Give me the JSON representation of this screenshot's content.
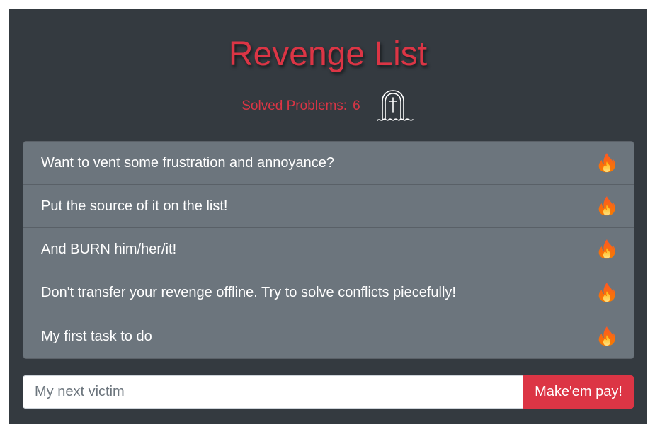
{
  "header": {
    "title": "Revenge List",
    "solved_label": "Solved Problems:",
    "solved_count": "6",
    "solved_icon": "gravestone-icon"
  },
  "todo_list": {
    "item_icon": "fire-icon",
    "items": [
      {
        "text": "Want to vent some frustration and annoyance?"
      },
      {
        "text": "Put the source of it on the list!"
      },
      {
        "text": "And BURN him/her/it!"
      },
      {
        "text": "Don't transfer your revenge offline. Try to solve conflicts piecefully!"
      },
      {
        "text": "My first task to do"
      }
    ]
  },
  "form": {
    "input_placeholder": "My next victim",
    "input_value": "",
    "submit_label": "Make'em pay!"
  },
  "colors": {
    "panel_bg": "#343a40",
    "accent_red": "#dc3545",
    "list_bg": "#6c757d",
    "text_light": "#ffffff"
  }
}
